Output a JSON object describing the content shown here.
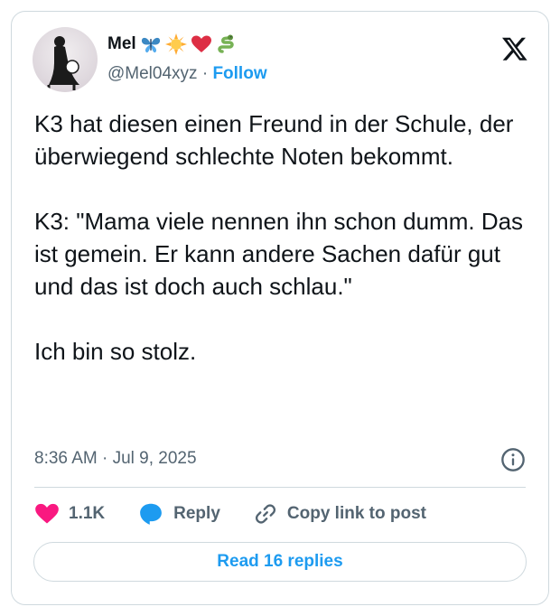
{
  "author": {
    "name": "Mel",
    "name_emojis": [
      "butterfly-icon",
      "sun-icon",
      "red-heart-icon",
      "snake-icon"
    ],
    "handle": "@Mel04xyz",
    "separator": "·",
    "follow_label": "Follow"
  },
  "post": {
    "text": "K3 hat diesen einen Freund in der Schule, der überwiegend schlechte Noten bekommt.\n\nK3: \"Mama viele nennen ihn schon dumm. Das ist gemein. Er kann andere Sachen dafür gut und das ist doch auch schlau.\"\n\nIch bin so stolz.",
    "timestamp": "8:36 AM · Jul 9, 2025"
  },
  "actions": {
    "like_count": "1.1K",
    "reply_label": "Reply",
    "copy_label": "Copy link to post"
  },
  "read_replies_label": "Read 16 replies",
  "colors": {
    "accent": "#1d9bf0",
    "heart": "#f91880",
    "secondary_text": "#536471",
    "border": "#cfd9de"
  }
}
